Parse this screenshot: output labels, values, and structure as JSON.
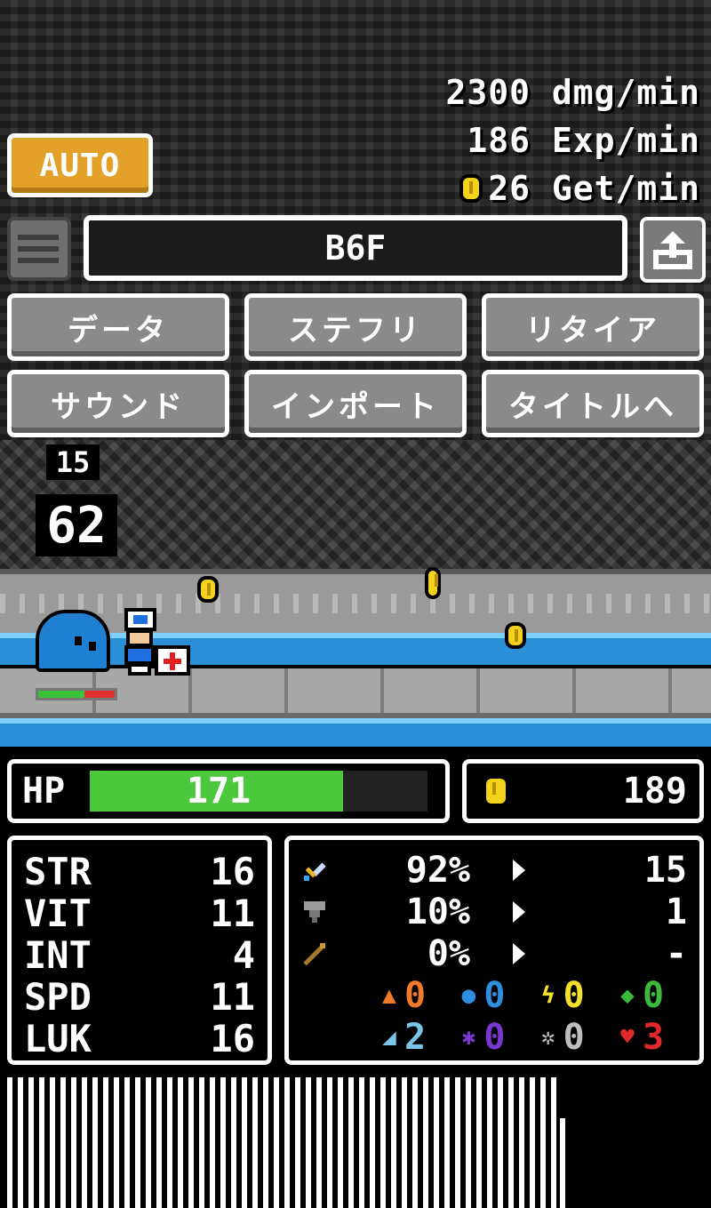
{
  "rates": {
    "damage": "2300 dmg/min",
    "exp": "186 Exp/min",
    "gold": "26 Get/min"
  },
  "auto_button": "AUTO",
  "floor": "B6F",
  "menu": [
    "データ",
    "ステフリ",
    "リタイア",
    "サウンド",
    "インポート",
    "タイトルへ"
  ],
  "counters": {
    "small": "15",
    "big": "62"
  },
  "player": {
    "hp_label": "HP",
    "hp_value": "171",
    "hp_fraction": 0.75,
    "gold": "189"
  },
  "enemy": {
    "hp_fraction": 0.6
  },
  "stats": [
    {
      "name": "STR",
      "value": "16"
    },
    {
      "name": "VIT",
      "value": "11"
    },
    {
      "name": "INT",
      "value": "4"
    },
    {
      "name": "SPD",
      "value": "11"
    },
    {
      "name": "LUK",
      "value": "16"
    }
  ],
  "equipment": [
    {
      "icon": "sword-icon",
      "pct": "92%",
      "count": "15"
    },
    {
      "icon": "shield-icon",
      "pct": "10%",
      "count": "1"
    },
    {
      "icon": "staff-icon",
      "pct": "0%",
      "count": "-"
    }
  ],
  "elements_row1": [
    {
      "icon": "fire-icon",
      "value": "0",
      "color": "#f07a28"
    },
    {
      "icon": "water-icon",
      "value": "0",
      "color": "#2e8fe0"
    },
    {
      "icon": "thunder-icon",
      "value": "0",
      "color": "#f2e02a"
    },
    {
      "icon": "wind-icon",
      "value": "0",
      "color": "#3cb83c"
    }
  ],
  "elements_row2": [
    {
      "icon": "ice-icon",
      "value": "2",
      "color": "#7ac6e8"
    },
    {
      "icon": "dark-icon",
      "value": "0",
      "color": "#7a38d0"
    },
    {
      "icon": "light-icon",
      "value": "0",
      "color": "#bdbdbd"
    },
    {
      "icon": "heart-icon",
      "value": "3",
      "color": "#e02a2a"
    }
  ],
  "colors": {
    "auto": "#e3a12a",
    "hp_bar": "#4cc83c",
    "coin": "#f2d21b",
    "water": "#2b8fd8"
  }
}
